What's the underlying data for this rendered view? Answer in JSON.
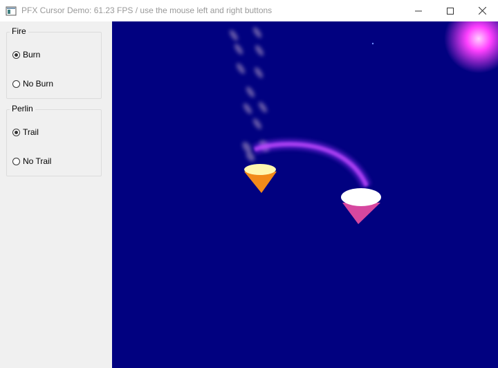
{
  "window": {
    "title": "PFX Cursor Demo: 61.23 FPS / use the mouse left and right buttons",
    "icon": "app-window-icon",
    "controls": [
      "minimize-icon",
      "maximize-icon",
      "close-icon"
    ]
  },
  "panel": {
    "fire": {
      "title": "Fire",
      "options": [
        {
          "label": "Burn",
          "selected": true
        },
        {
          "label": "No Burn",
          "selected": false
        }
      ]
    },
    "perlin": {
      "title": "Perlin",
      "options": [
        {
          "label": "Trail",
          "selected": true
        },
        {
          "label": "No Trail",
          "selected": false
        }
      ]
    }
  },
  "scene": {
    "background_color": "#010180",
    "cursor_colors": {
      "orange_cone": "#f28a1a",
      "pink_cone": "#d6479f",
      "trail": "#b030ff",
      "glow": "#ff40ff"
    }
  }
}
